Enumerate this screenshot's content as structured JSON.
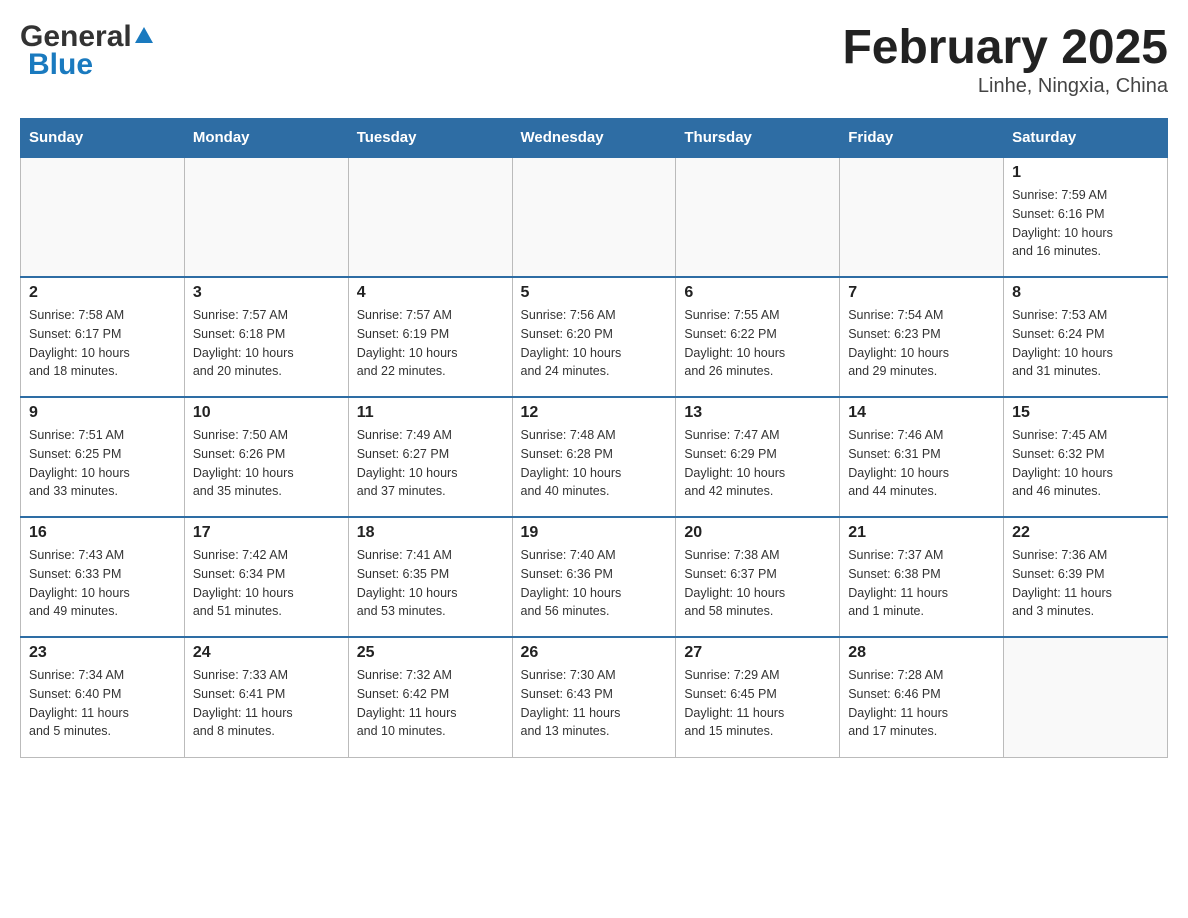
{
  "header": {
    "logo_general": "General",
    "logo_blue": "Blue",
    "month_title": "February 2025",
    "location": "Linhe, Ningxia, China"
  },
  "weekdays": [
    "Sunday",
    "Monday",
    "Tuesday",
    "Wednesday",
    "Thursday",
    "Friday",
    "Saturday"
  ],
  "weeks": [
    [
      {
        "day": "",
        "info": ""
      },
      {
        "day": "",
        "info": ""
      },
      {
        "day": "",
        "info": ""
      },
      {
        "day": "",
        "info": ""
      },
      {
        "day": "",
        "info": ""
      },
      {
        "day": "",
        "info": ""
      },
      {
        "day": "1",
        "info": "Sunrise: 7:59 AM\nSunset: 6:16 PM\nDaylight: 10 hours\nand 16 minutes."
      }
    ],
    [
      {
        "day": "2",
        "info": "Sunrise: 7:58 AM\nSunset: 6:17 PM\nDaylight: 10 hours\nand 18 minutes."
      },
      {
        "day": "3",
        "info": "Sunrise: 7:57 AM\nSunset: 6:18 PM\nDaylight: 10 hours\nand 20 minutes."
      },
      {
        "day": "4",
        "info": "Sunrise: 7:57 AM\nSunset: 6:19 PM\nDaylight: 10 hours\nand 22 minutes."
      },
      {
        "day": "5",
        "info": "Sunrise: 7:56 AM\nSunset: 6:20 PM\nDaylight: 10 hours\nand 24 minutes."
      },
      {
        "day": "6",
        "info": "Sunrise: 7:55 AM\nSunset: 6:22 PM\nDaylight: 10 hours\nand 26 minutes."
      },
      {
        "day": "7",
        "info": "Sunrise: 7:54 AM\nSunset: 6:23 PM\nDaylight: 10 hours\nand 29 minutes."
      },
      {
        "day": "8",
        "info": "Sunrise: 7:53 AM\nSunset: 6:24 PM\nDaylight: 10 hours\nand 31 minutes."
      }
    ],
    [
      {
        "day": "9",
        "info": "Sunrise: 7:51 AM\nSunset: 6:25 PM\nDaylight: 10 hours\nand 33 minutes."
      },
      {
        "day": "10",
        "info": "Sunrise: 7:50 AM\nSunset: 6:26 PM\nDaylight: 10 hours\nand 35 minutes."
      },
      {
        "day": "11",
        "info": "Sunrise: 7:49 AM\nSunset: 6:27 PM\nDaylight: 10 hours\nand 37 minutes."
      },
      {
        "day": "12",
        "info": "Sunrise: 7:48 AM\nSunset: 6:28 PM\nDaylight: 10 hours\nand 40 minutes."
      },
      {
        "day": "13",
        "info": "Sunrise: 7:47 AM\nSunset: 6:29 PM\nDaylight: 10 hours\nand 42 minutes."
      },
      {
        "day": "14",
        "info": "Sunrise: 7:46 AM\nSunset: 6:31 PM\nDaylight: 10 hours\nand 44 minutes."
      },
      {
        "day": "15",
        "info": "Sunrise: 7:45 AM\nSunset: 6:32 PM\nDaylight: 10 hours\nand 46 minutes."
      }
    ],
    [
      {
        "day": "16",
        "info": "Sunrise: 7:43 AM\nSunset: 6:33 PM\nDaylight: 10 hours\nand 49 minutes."
      },
      {
        "day": "17",
        "info": "Sunrise: 7:42 AM\nSunset: 6:34 PM\nDaylight: 10 hours\nand 51 minutes."
      },
      {
        "day": "18",
        "info": "Sunrise: 7:41 AM\nSunset: 6:35 PM\nDaylight: 10 hours\nand 53 minutes."
      },
      {
        "day": "19",
        "info": "Sunrise: 7:40 AM\nSunset: 6:36 PM\nDaylight: 10 hours\nand 56 minutes."
      },
      {
        "day": "20",
        "info": "Sunrise: 7:38 AM\nSunset: 6:37 PM\nDaylight: 10 hours\nand 58 minutes."
      },
      {
        "day": "21",
        "info": "Sunrise: 7:37 AM\nSunset: 6:38 PM\nDaylight: 11 hours\nand 1 minute."
      },
      {
        "day": "22",
        "info": "Sunrise: 7:36 AM\nSunset: 6:39 PM\nDaylight: 11 hours\nand 3 minutes."
      }
    ],
    [
      {
        "day": "23",
        "info": "Sunrise: 7:34 AM\nSunset: 6:40 PM\nDaylight: 11 hours\nand 5 minutes."
      },
      {
        "day": "24",
        "info": "Sunrise: 7:33 AM\nSunset: 6:41 PM\nDaylight: 11 hours\nand 8 minutes."
      },
      {
        "day": "25",
        "info": "Sunrise: 7:32 AM\nSunset: 6:42 PM\nDaylight: 11 hours\nand 10 minutes."
      },
      {
        "day": "26",
        "info": "Sunrise: 7:30 AM\nSunset: 6:43 PM\nDaylight: 11 hours\nand 13 minutes."
      },
      {
        "day": "27",
        "info": "Sunrise: 7:29 AM\nSunset: 6:45 PM\nDaylight: 11 hours\nand 15 minutes."
      },
      {
        "day": "28",
        "info": "Sunrise: 7:28 AM\nSunset: 6:46 PM\nDaylight: 11 hours\nand 17 minutes."
      },
      {
        "day": "",
        "info": ""
      }
    ]
  ]
}
